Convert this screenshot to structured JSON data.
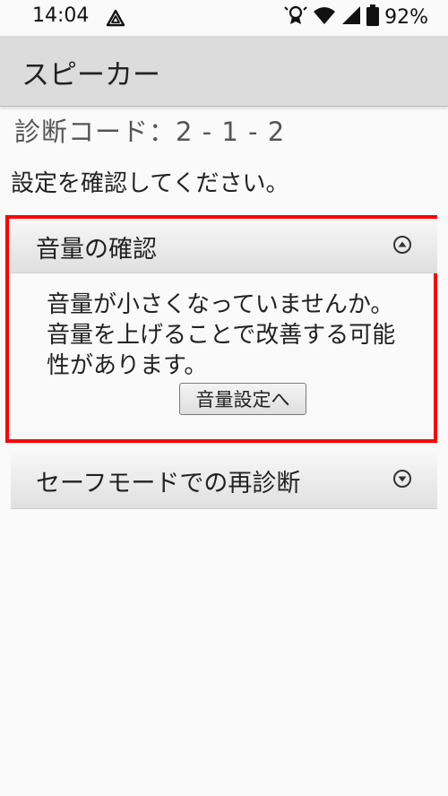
{
  "status_bar": {
    "time": "14:04",
    "battery_percent": "92%",
    "icons": [
      "assistant-icon",
      "security-icon",
      "wifi-icon",
      "signal-icon",
      "battery-icon"
    ]
  },
  "app_bar": {
    "title": "スピーカー"
  },
  "diagnosis_code": "診断コード：2 - 1 - 2",
  "instruction": "設定を確認してください。",
  "accordion": [
    {
      "title": "音量の確認",
      "expanded": true,
      "body_text": "音量が小さくなっていませんか。\n音量を上げることで改善する可能\n性があります。",
      "button_label": "音量設定へ"
    },
    {
      "title": "セーフモードでの再診断",
      "expanded": false
    }
  ],
  "colors": {
    "highlight": "#ff0000",
    "app_bar": "#dcdcdc",
    "background": "#fafafa"
  }
}
